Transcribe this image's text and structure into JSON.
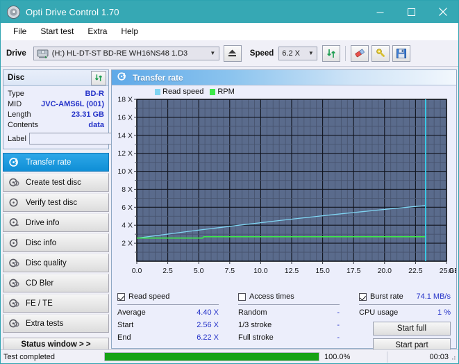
{
  "window": {
    "title": "Opti Drive Control 1.70",
    "icon": "disc-icon",
    "controls": {
      "minimize": "minimize-icon",
      "maximize": "maximize-icon",
      "close": "close-icon"
    },
    "titlebar_color": "#36a8b4"
  },
  "menu": {
    "items": [
      "File",
      "Start test",
      "Extra",
      "Help"
    ]
  },
  "toolbar": {
    "drive_label": "Drive",
    "drive_value": "(H:)  HL-DT-ST BD-RE  WH16NS48 1.D3",
    "eject_icon": "eject-icon",
    "speed_label": "Speed",
    "speed_value": "6.2 X",
    "refresh_icon": "refresh-icon",
    "erase_icon": "eraser-icon",
    "key_icon": "key-icon",
    "save_icon": "save-disk-icon"
  },
  "disc": {
    "title": "Disc",
    "refresh_icon": "refresh-icon",
    "rows": [
      {
        "key": "Type",
        "value": "BD-R"
      },
      {
        "key": "MID",
        "value": "JVC-AMS6L (001)"
      },
      {
        "key": "Length",
        "value": "23.31 GB"
      },
      {
        "key": "Contents",
        "value": "data"
      }
    ],
    "label_key": "Label",
    "label_value": "",
    "label_placeholder": "",
    "label_button_icon": "cd-icon"
  },
  "nav": {
    "items": [
      {
        "label": "Transfer rate",
        "icon": "disc-test-icon",
        "active": true
      },
      {
        "label": "Create test disc",
        "icon": "disc-create-icon",
        "active": false
      },
      {
        "label": "Verify test disc",
        "icon": "disc-verify-icon",
        "active": false
      },
      {
        "label": "Drive info",
        "icon": "drive-info-icon",
        "active": false
      },
      {
        "label": "Disc info",
        "icon": "disc-info-icon",
        "active": false
      },
      {
        "label": "Disc quality",
        "icon": "disc-quality-icon",
        "active": false
      },
      {
        "label": "CD Bler",
        "icon": "cd-bler-icon",
        "active": false
      },
      {
        "label": "FE / TE",
        "icon": "fe-te-icon",
        "active": false
      },
      {
        "label": "Extra tests",
        "icon": "extra-tests-icon",
        "active": false
      }
    ],
    "status_window_label": "Status window > >"
  },
  "panel": {
    "title": "Transfer rate",
    "icon": "transfer-rate-icon"
  },
  "chart_data": {
    "type": "line",
    "title": "Transfer rate",
    "xlabel": "GB",
    "ylabel": "X",
    "xlim": [
      0.0,
      25.0
    ],
    "ylim": [
      0,
      18
    ],
    "xticks": [
      "0.0",
      "2.5",
      "5.0",
      "7.5",
      "10.0",
      "12.5",
      "15.0",
      "17.5",
      "20.0",
      "22.5",
      "25.0"
    ],
    "xtick_values": [
      0.0,
      2.5,
      5.0,
      7.5,
      10.0,
      12.5,
      15.0,
      17.5,
      20.0,
      22.5,
      25.0
    ],
    "yticks": [
      "2 X",
      "4 X",
      "6 X",
      "8 X",
      "10 X",
      "12 X",
      "14 X",
      "16 X",
      "18 X"
    ],
    "ytick_values": [
      2,
      4,
      6,
      8,
      10,
      12,
      14,
      16,
      18
    ],
    "grid": true,
    "plot_bg": "#5a6b8c",
    "legend": [
      {
        "name": "Read speed",
        "color": "#7fd4f2"
      },
      {
        "name": "RPM",
        "color": "#3de84a"
      }
    ],
    "series": [
      {
        "name": "Read speed",
        "color": "#7fd4f2",
        "x": [
          0.0,
          1.0,
          2.0,
          3.0,
          4.0,
          5.0,
          6.0,
          7.0,
          8.0,
          9.0,
          10.0,
          11.0,
          12.0,
          13.0,
          14.0,
          15.0,
          16.0,
          17.0,
          18.0,
          19.0,
          20.0,
          21.0,
          22.0,
          23.0,
          23.31
        ],
        "y": [
          2.56,
          2.74,
          2.92,
          3.1,
          3.28,
          3.46,
          3.62,
          3.79,
          3.96,
          4.12,
          4.28,
          4.44,
          4.6,
          4.75,
          4.9,
          5.05,
          5.2,
          5.34,
          5.48,
          5.62,
          5.76,
          5.89,
          6.02,
          6.15,
          6.22
        ]
      },
      {
        "name": "RPM",
        "color": "#3de84a",
        "x": [
          0.0,
          5.3,
          5.4,
          23.31
        ],
        "y": [
          2.57,
          2.57,
          2.72,
          2.72
        ]
      }
    ],
    "marker_line": {
      "x": 23.31,
      "color": "#35d6f0"
    }
  },
  "stats": {
    "read_speed": {
      "checkbox_label": "Read speed",
      "checked": true,
      "rows": [
        {
          "key": "Average",
          "value": "4.40 X"
        },
        {
          "key": "Start",
          "value": "2.56 X"
        },
        {
          "key": "End",
          "value": "6.22 X"
        }
      ]
    },
    "access_times": {
      "checkbox_label": "Access times",
      "checked": false,
      "rows": [
        {
          "key": "Random",
          "value": "-"
        },
        {
          "key": "1/3 stroke",
          "value": "-"
        },
        {
          "key": "Full stroke",
          "value": "-"
        }
      ]
    },
    "burst_rate": {
      "checkbox_label": "Burst rate",
      "checked": true,
      "value": "74.1 MB/s",
      "rows": [
        {
          "key": "CPU usage",
          "value": "1 %"
        }
      ]
    },
    "buttons": [
      {
        "label": "Start full"
      },
      {
        "label": "Start part"
      }
    ]
  },
  "statusbar": {
    "text": "Test completed",
    "progress_percent": 100.0,
    "progress_label": "100.0%",
    "elapsed": "00:03",
    "progress_color": "#16a316"
  }
}
